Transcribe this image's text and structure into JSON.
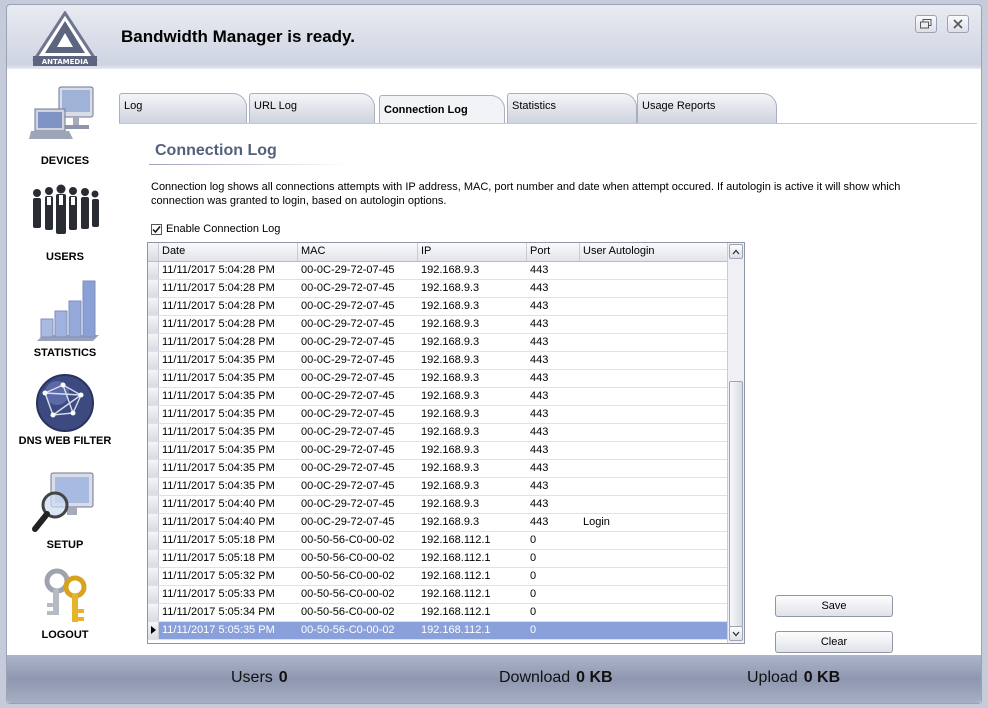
{
  "app": {
    "title": "Bandwidth Manager is ready.",
    "logo_text": "ANTAMEDIA"
  },
  "sidebar": {
    "items": [
      {
        "label": "DEVICES",
        "icon": "computer-icon"
      },
      {
        "label": "USERS",
        "icon": "people-icon"
      },
      {
        "label": "STATISTICS",
        "icon": "bar-chart-icon"
      },
      {
        "label": "DNS WEB FILTER",
        "icon": "globe-network-icon"
      },
      {
        "label": "SETUP",
        "icon": "magnifier-monitor-icon"
      },
      {
        "label": "LOGOUT",
        "icon": "keys-icon"
      }
    ]
  },
  "tabs": [
    {
      "label": "Log",
      "active": false
    },
    {
      "label": "URL Log",
      "active": false
    },
    {
      "label": "Connection Log",
      "active": true
    },
    {
      "label": "Statistics",
      "active": false
    },
    {
      "label": "Usage Reports",
      "active": false
    }
  ],
  "panel": {
    "title": "Connection Log",
    "description": "Connection log shows all connections attempts with IP address, MAC, port number and date when attempt occured. If autologin is active it will show which connection was granted to login, based on autologin options.",
    "enable_label": "Enable Connection Log",
    "enable_checked": true
  },
  "grid": {
    "columns": [
      "Date",
      "MAC",
      "IP",
      "Port",
      "User Autologin"
    ],
    "rows": [
      [
        "11/11/2017 5:04:28 PM",
        "00-0C-29-72-07-45",
        "192.168.9.3",
        "443",
        ""
      ],
      [
        "11/11/2017 5:04:28 PM",
        "00-0C-29-72-07-45",
        "192.168.9.3",
        "443",
        ""
      ],
      [
        "11/11/2017 5:04:28 PM",
        "00-0C-29-72-07-45",
        "192.168.9.3",
        "443",
        ""
      ],
      [
        "11/11/2017 5:04:28 PM",
        "00-0C-29-72-07-45",
        "192.168.9.3",
        "443",
        ""
      ],
      [
        "11/11/2017 5:04:28 PM",
        "00-0C-29-72-07-45",
        "192.168.9.3",
        "443",
        ""
      ],
      [
        "11/11/2017 5:04:35 PM",
        "00-0C-29-72-07-45",
        "192.168.9.3",
        "443",
        ""
      ],
      [
        "11/11/2017 5:04:35 PM",
        "00-0C-29-72-07-45",
        "192.168.9.3",
        "443",
        ""
      ],
      [
        "11/11/2017 5:04:35 PM",
        "00-0C-29-72-07-45",
        "192.168.9.3",
        "443",
        ""
      ],
      [
        "11/11/2017 5:04:35 PM",
        "00-0C-29-72-07-45",
        "192.168.9.3",
        "443",
        ""
      ],
      [
        "11/11/2017 5:04:35 PM",
        "00-0C-29-72-07-45",
        "192.168.9.3",
        "443",
        ""
      ],
      [
        "11/11/2017 5:04:35 PM",
        "00-0C-29-72-07-45",
        "192.168.9.3",
        "443",
        ""
      ],
      [
        "11/11/2017 5:04:35 PM",
        "00-0C-29-72-07-45",
        "192.168.9.3",
        "443",
        ""
      ],
      [
        "11/11/2017 5:04:35 PM",
        "00-0C-29-72-07-45",
        "192.168.9.3",
        "443",
        ""
      ],
      [
        "11/11/2017 5:04:40 PM",
        "00-0C-29-72-07-45",
        "192.168.9.3",
        "443",
        ""
      ],
      [
        "11/11/2017 5:04:40 PM",
        "00-0C-29-72-07-45",
        "192.168.9.3",
        "443",
        "Login"
      ],
      [
        "11/11/2017 5:05:18 PM",
        "00-50-56-C0-00-02",
        "192.168.112.1",
        "0",
        ""
      ],
      [
        "11/11/2017 5:05:18 PM",
        "00-50-56-C0-00-02",
        "192.168.112.1",
        "0",
        ""
      ],
      [
        "11/11/2017 5:05:32 PM",
        "00-50-56-C0-00-02",
        "192.168.112.1",
        "0",
        ""
      ],
      [
        "11/11/2017 5:05:33 PM",
        "00-50-56-C0-00-02",
        "192.168.112.1",
        "0",
        ""
      ],
      [
        "11/11/2017 5:05:34 PM",
        "00-50-56-C0-00-02",
        "192.168.112.1",
        "0",
        ""
      ],
      [
        "11/11/2017 5:05:35 PM",
        "00-50-56-C0-00-02",
        "192.168.112.1",
        "0",
        ""
      ]
    ],
    "selected_row": 20
  },
  "buttons": {
    "save": "Save",
    "clear": "Clear"
  },
  "status": {
    "users_label": "Users",
    "users_value": "0",
    "download_label": "Download",
    "download_value": "0 KB",
    "upload_label": "Upload",
    "upload_value": "0 KB"
  },
  "colors": {
    "selection": "#8aa0db",
    "title_text": "#55607a",
    "status_bar": "#8e97b0"
  }
}
